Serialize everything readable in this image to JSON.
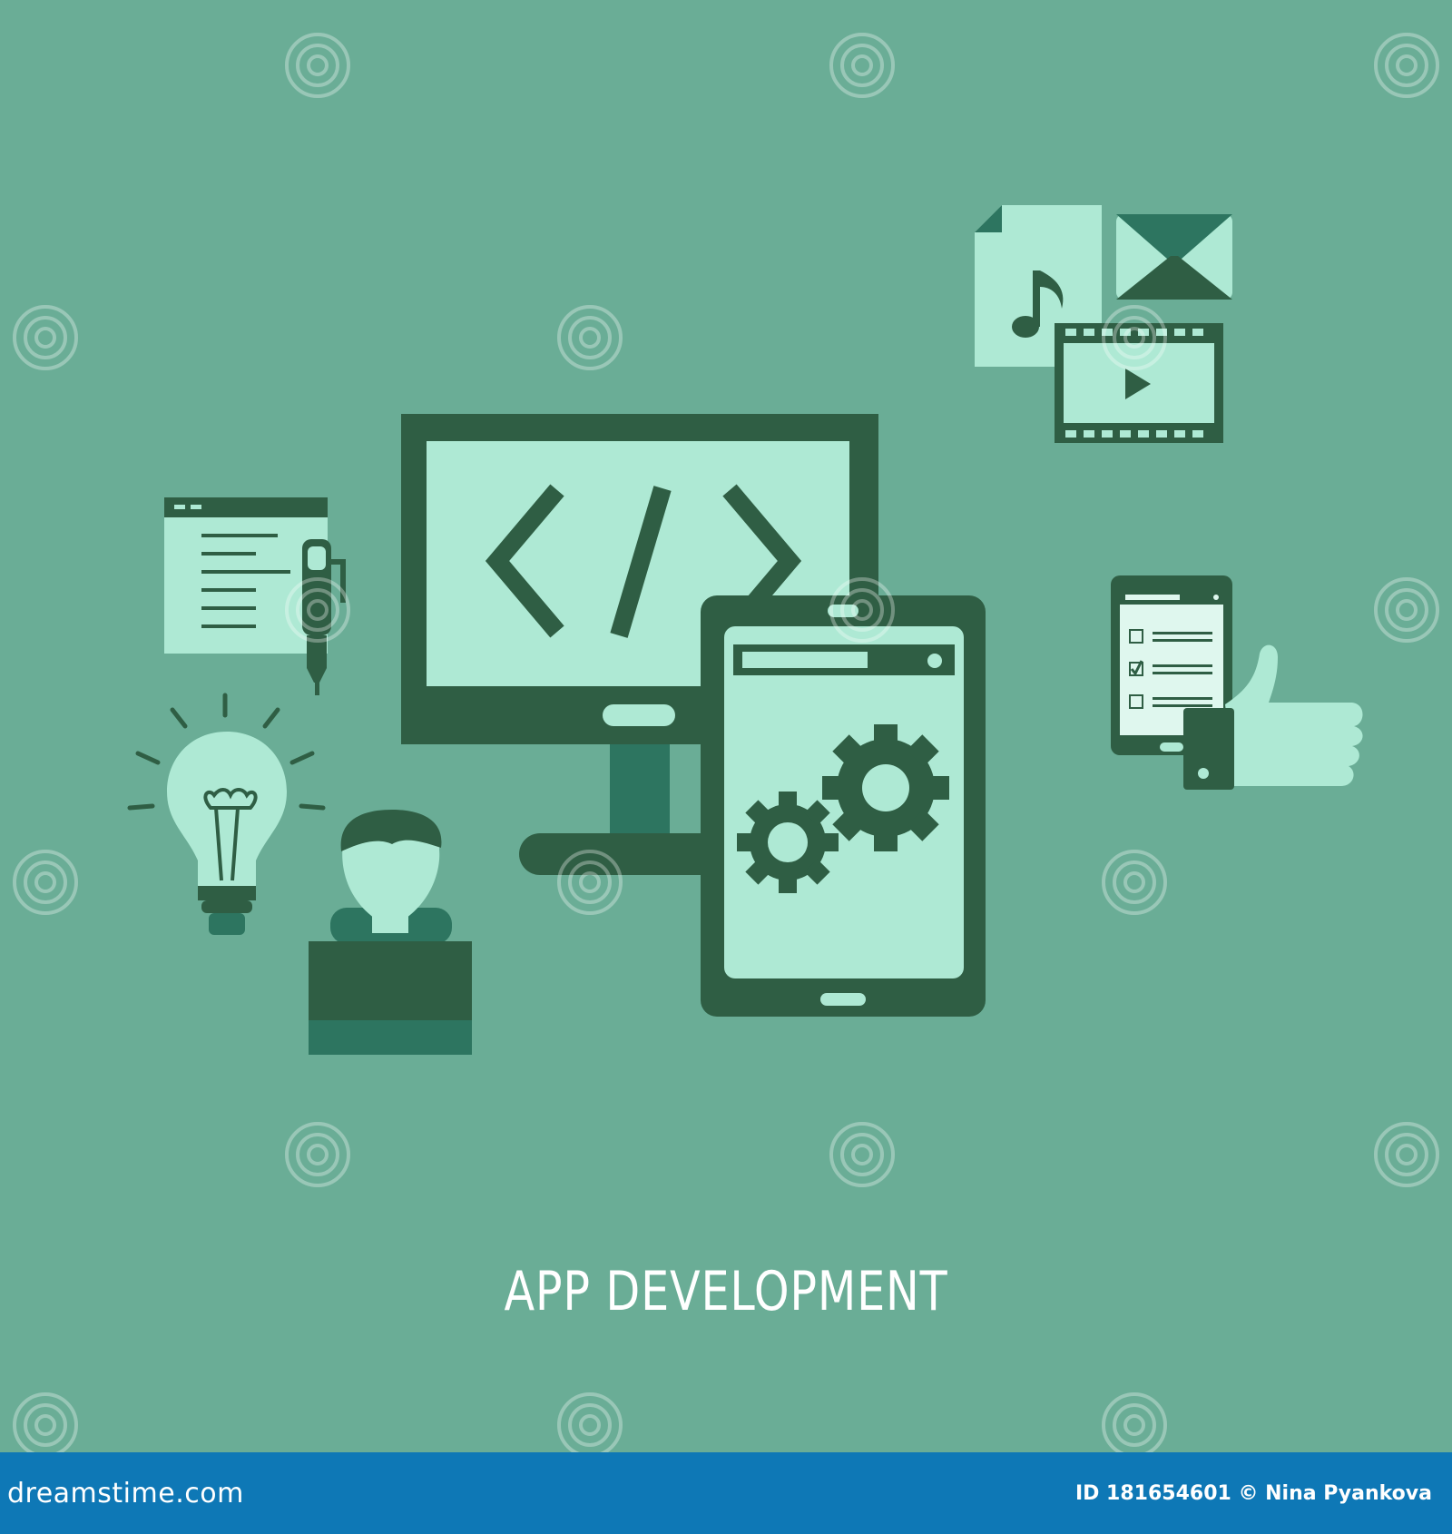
{
  "illustration": {
    "caption": "APP DEVELOPMENT",
    "code_glyph": "</>",
    "background_color": "#6aad96",
    "dark_color": "#2f5e44",
    "mid_color": "#2d7560",
    "light_color": "#aee9d4",
    "icons": [
      "code-window-icon",
      "pen-icon",
      "light-bulb-icon",
      "developer-icon",
      "laptop-icon",
      "monitor-icon",
      "tablet-icon",
      "gears-icon",
      "music-file-icon",
      "mail-icon",
      "video-icon",
      "checklist-phone-icon",
      "thumbs-up-icon"
    ]
  },
  "watermark": {
    "text": "dreamstime",
    "logo": "spiral-logo-icon"
  },
  "footer": {
    "brand": "dreamstime.com",
    "image_id": "ID 181654601",
    "credit": "© Nina  Pyankova",
    "background_color": "#0e78b6"
  }
}
